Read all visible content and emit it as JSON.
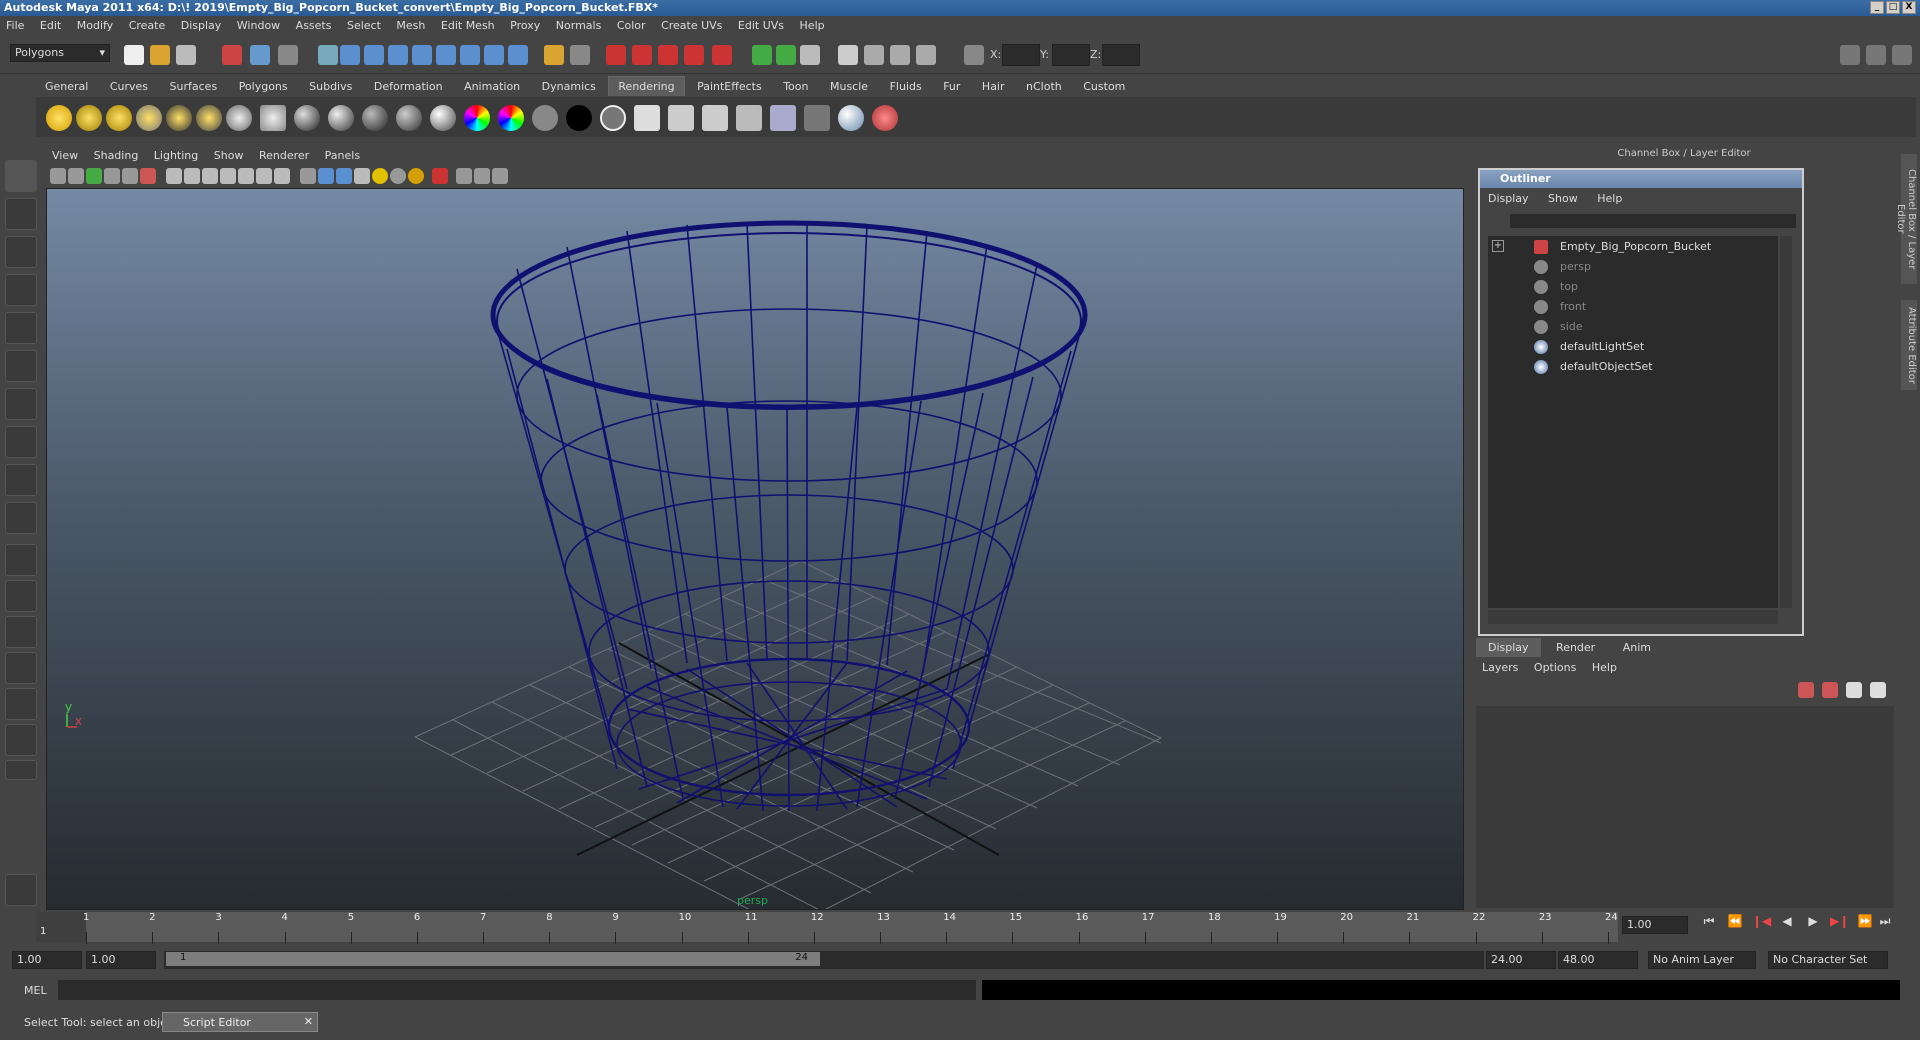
{
  "window": {
    "title": "Autodesk Maya 2011 x64: D:\\! 2019\\Empty_Big_Popcorn_Bucket_convert\\Empty_Big_Popcorn_Bucket.FBX*",
    "minimize": "_",
    "maximize": "□",
    "close": "X"
  },
  "menubar": [
    "File",
    "Edit",
    "Modify",
    "Create",
    "Display",
    "Window",
    "Assets",
    "Select",
    "Mesh",
    "Edit Mesh",
    "Proxy",
    "Normals",
    "Color",
    "Create UVs",
    "Edit UVs",
    "Help"
  ],
  "statusline": {
    "menuset": "Polygons",
    "x_label": "X:",
    "y_label": "Y:",
    "z_label": "Z:"
  },
  "shelf": {
    "tabs": [
      "General",
      "Curves",
      "Surfaces",
      "Polygons",
      "Subdivs",
      "Deformation",
      "Animation",
      "Dynamics",
      "Rendering",
      "PaintEffects",
      "Toon",
      "Muscle",
      "Fluids",
      "Fur",
      "Hair",
      "nCloth",
      "Custom"
    ],
    "active_tab": "Rendering"
  },
  "viewport": {
    "menu": [
      "View",
      "Shading",
      "Lighting",
      "Show",
      "Renderer",
      "Panels"
    ],
    "camera_label": "persp",
    "axis_y": "y",
    "axis_x": "x",
    "wire_color": "#101070"
  },
  "right_panel": {
    "header": "Channel Box / Layer Editor",
    "vertical_tabs": [
      "Channel Box / Layer Editor",
      "Attribute Editor"
    ]
  },
  "outliner": {
    "title": "Outliner",
    "menu": [
      "Display",
      "Show",
      "Help"
    ],
    "items": [
      {
        "label": "Empty_Big_Popcorn_Bucket",
        "dim": false,
        "icon": "mesh-icon",
        "expand": "+"
      },
      {
        "label": "persp",
        "dim": true,
        "icon": "camera-icon"
      },
      {
        "label": "top",
        "dim": true,
        "icon": "camera-icon"
      },
      {
        "label": "front",
        "dim": true,
        "icon": "camera-icon"
      },
      {
        "label": "side",
        "dim": true,
        "icon": "camera-icon"
      },
      {
        "label": "defaultLightSet",
        "dim": false,
        "icon": "set-icon"
      },
      {
        "label": "defaultObjectSet",
        "dim": false,
        "icon": "set-icon"
      }
    ]
  },
  "layer_editor": {
    "tabs": [
      "Display",
      "Render",
      "Anim"
    ],
    "active_tab": "Display",
    "menu": [
      "Layers",
      "Options",
      "Help"
    ]
  },
  "timeslider": {
    "frames": [
      "1",
      "2",
      "3",
      "4",
      "5",
      "6",
      "7",
      "8",
      "9",
      "10",
      "11",
      "12",
      "13",
      "14",
      "15",
      "16",
      "17",
      "18",
      "19",
      "20",
      "21",
      "22",
      "23",
      "24"
    ],
    "current_frame_marker": "1",
    "current_time": "1.00"
  },
  "rangeslider": {
    "start_time": "1.00",
    "playback_start": "1.00",
    "range_start_label": "1",
    "range_end_label": "24",
    "playback_end": "24.00",
    "end_time": "48.00",
    "anim_layer": "No Anim Layer",
    "character_set": "No Character Set"
  },
  "commandline": {
    "label": "MEL"
  },
  "helpline": {
    "text": "Select Tool: select an object",
    "script_editor": "Script Editor"
  }
}
